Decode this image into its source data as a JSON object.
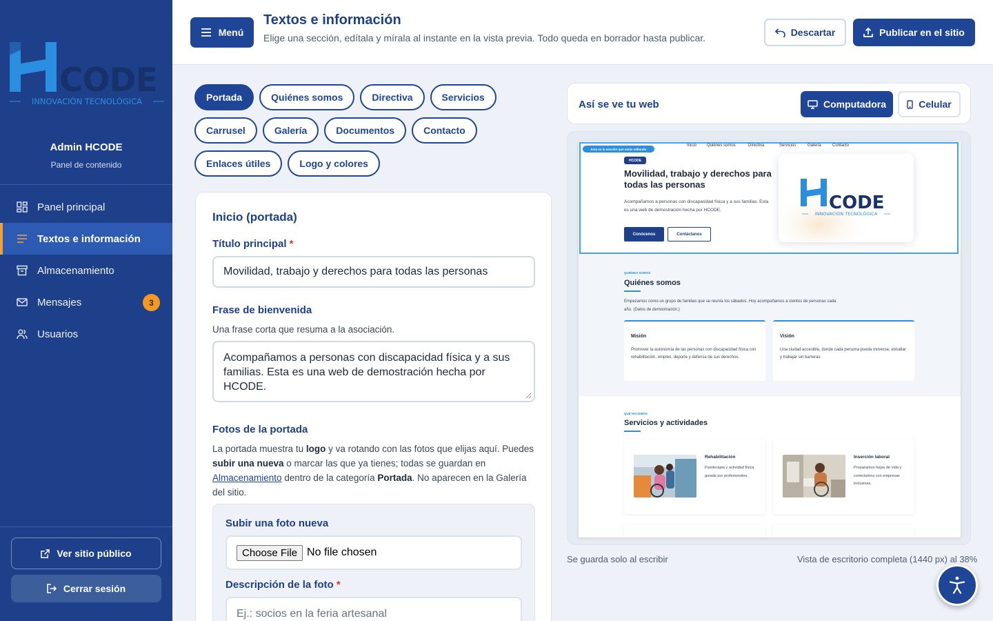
{
  "brand": {
    "logo_letter": "H",
    "logo_word": "CODE",
    "logo_tagline": "INNOVACIÓN TECNOLÓGICA",
    "colors": {
      "primary": "#1e4596",
      "sidebar": "#1e3f8a",
      "accent": "#2a8fe0",
      "badge": "#f39a1e",
      "active_marker": "#f2a03a"
    }
  },
  "sidebar": {
    "user_name": "Admin HCODE",
    "user_role": "Panel de contenido",
    "items": [
      {
        "label": "Panel principal",
        "icon": "dashboard-icon"
      },
      {
        "label": "Textos e información",
        "icon": "lines-icon",
        "active": true
      },
      {
        "label": "Almacenamiento",
        "icon": "archive-icon"
      },
      {
        "label": "Mensajes",
        "icon": "mail-icon",
        "badge": "3"
      },
      {
        "label": "Usuarios",
        "icon": "users-icon"
      }
    ],
    "public_site_label": "Ver sitio público",
    "logout_label": "Cerrar sesión"
  },
  "header": {
    "menu_label": "Menú",
    "title": "Textos e información",
    "subtitle": "Elige una sección, edítala y mírala al instante en la vista previa. Todo queda en borrador hasta publicar.",
    "discard_label": "Descartar",
    "publish_label": "Publicar en el sitio"
  },
  "tabs": [
    "Portada",
    "Quiénes somos",
    "Directiva",
    "Servicios",
    "Carrusel",
    "Galería",
    "Documentos",
    "Contacto",
    "Enlaces útiles",
    "Logo y colores"
  ],
  "active_tab": "Portada",
  "form": {
    "section_title": "Inicio (portada)",
    "title_label": "Título principal",
    "required_mark": "*",
    "title_value": "Movilidad, trabajo y derechos para todas las personas",
    "welcome_label": "Frase de bienvenida",
    "welcome_help": "Una frase corta que resuma a la asociación.",
    "welcome_value": "Acompañamos a personas con discapacidad física y a sus familias. Esta es una web de demostración hecha por HCODE.",
    "photos_label": "Fotos de la portada",
    "photos_help": {
      "t1": "La portada muestra tu ",
      "b1": "logo",
      "t2": " y va rotando con las fotos que elijas aquí. Puedes ",
      "b2": "subir una nueva",
      "t3": " o marcar las que ya tienes; todas se guardan en ",
      "link": "Almacenamiento",
      "t4": " dentro de la categoría ",
      "b3": "Portada",
      "t5": ". No aparecen en la Galería del sitio."
    },
    "upload_label": "Subir una foto nueva",
    "choose_file": "Choose File",
    "no_file": "No file chosen",
    "desc_label": "Descripción de la foto",
    "desc_placeholder": "Ej.: socios en la feria artesanal"
  },
  "preview": {
    "title": "Así se ve tu web",
    "desktop_label": "Computadora",
    "mobile_label": "Celular",
    "note_left": "Se guarda solo al escribir",
    "note_right": "Vista de escritorio completa (1440 px) al 38%",
    "mini": {
      "editing_tag": "Esta es la sección que estás editando",
      "nav": [
        "Inicio",
        "Quiénes somos",
        "Directiva",
        "Servicios",
        "Galería",
        "Contacto"
      ],
      "hero_pill": "HCODE",
      "hero_title": "Movilidad, trabajo y derechos para todas las personas",
      "hero_text": "Acompañamos a personas con discapacidad física y a sus familias. Esta es una web de demostración hecha por HCODE.",
      "btn_primary": "Conócenos",
      "btn_secondary": "Contáctanos",
      "about_eyebrow": "QUIÉNES SOMOS",
      "about_title": "Quiénes somos",
      "about_text": "Empezamos como un grupo de familias que se reunía los sábados. Hoy acompañamos a cientos de personas cada año. (Datos de demostración.)",
      "mission_title": "Misión",
      "mission_text": "Promover la autonomía de las personas con discapacidad física con rehabilitación, empleo, deporte y defensa de sus derechos.",
      "vision_title": "Visión",
      "vision_text": "Una ciudad accesible, donde cada persona pueda moverse, estudiar y trabajar sin barreras.",
      "services_eyebrow": "QUÉ HACEMOS",
      "services_title": "Servicios y actividades",
      "service1_title": "Rehabilitación",
      "service1_text": "Fisioterapia y actividad física guiada por profesionales.",
      "service2_title": "Inserción laboral",
      "service2_text": "Preparamos hojas de vida y conectamos con empresas inclusivas."
    }
  }
}
